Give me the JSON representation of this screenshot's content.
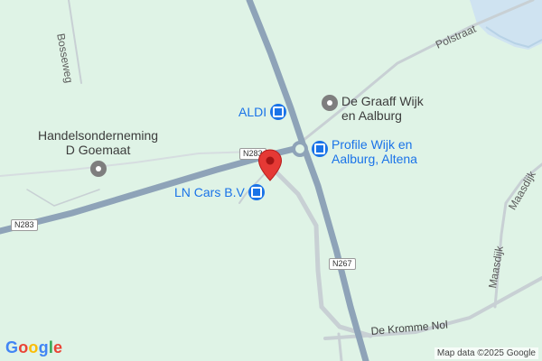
{
  "roads": {
    "bosseweg": "Bosseweg",
    "polstraat": "Polstraat",
    "maasdijk_1": "Maasdijk",
    "maasdijk_2": "Maasdijk",
    "de_kromme_nol": "De Kromme Nol"
  },
  "shields": {
    "n283_left": "N283",
    "n283_center": "N283",
    "n267": "N267"
  },
  "pois": {
    "aldi": {
      "label": "ALDI",
      "icon": "shopping-bag-icon"
    },
    "de_graaff": {
      "line1": "De Graaff Wijk",
      "line2": "en Aalburg",
      "icon": "place-icon"
    },
    "handels": {
      "line1": "Handelsonderneming",
      "line2": "D Goemaat",
      "icon": "place-icon"
    },
    "profile": {
      "line1": "Profile Wijk en",
      "line2": "Aalburg, Altena",
      "icon": "shopping-bag-icon"
    },
    "ln_cars": {
      "label": "LN Cars B.V",
      "icon": "shopping-bag-icon"
    }
  },
  "marker": {
    "icon": "red-location-pin-icon",
    "color": "#e53935"
  },
  "colors": {
    "land": "#dff3e6",
    "major_road": "#8ea3b8",
    "minor_road": "#c8d0d4",
    "water": "#b3d3ec",
    "poi_shop": "#1a73e8"
  },
  "footer": {
    "logo": [
      "G",
      "o",
      "o",
      "g",
      "l",
      "e"
    ],
    "attribution": "Map data ©2025 Google"
  }
}
